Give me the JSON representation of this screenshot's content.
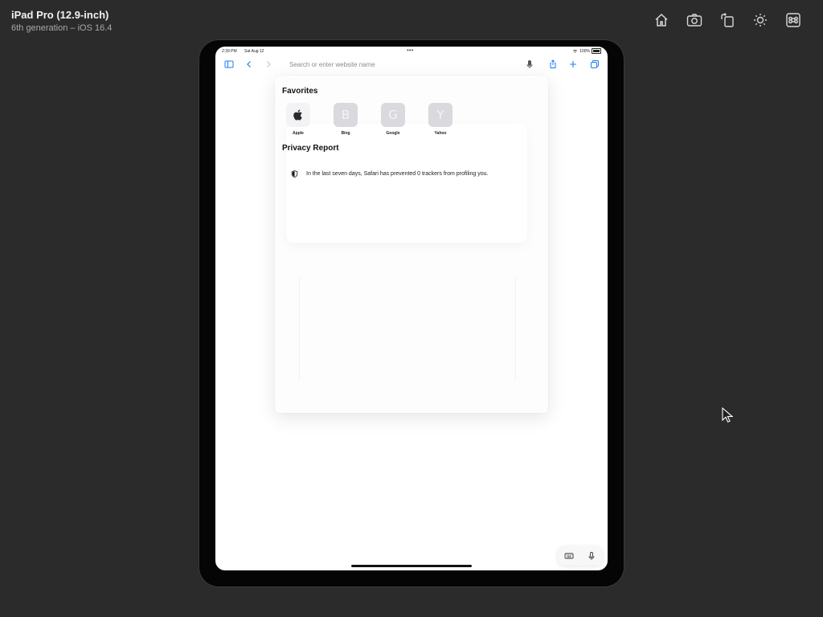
{
  "simulator": {
    "device_name": "iPad Pro (12.9-inch)",
    "device_subtitle": "6th generation – iOS 16.4",
    "toolbar": [
      {
        "icon": "home-icon"
      },
      {
        "icon": "screenshot-icon"
      },
      {
        "icon": "rotate-icon"
      },
      {
        "icon": "appearance-icon"
      },
      {
        "icon": "command-icon"
      }
    ]
  },
  "statusbar": {
    "time": "2:39 PM",
    "date": "Sat Aug 12",
    "battery": "100%"
  },
  "safari": {
    "address_placeholder": "Search or enter website name",
    "favorites_title": "Favorites",
    "favorites": [
      {
        "label": "Apple",
        "letter": ""
      },
      {
        "label": "Bing",
        "letter": "B"
      },
      {
        "label": "Google",
        "letter": "G"
      },
      {
        "label": "Yahoo",
        "letter": "Y"
      }
    ],
    "privacy_title": "Privacy Report",
    "privacy_text": "In the last seven days, Safari has prevented 0 trackers from profiling you."
  },
  "colors": {
    "background": "#2b2b2b",
    "tint": "#1a7cf5",
    "tile": "#d9d9de"
  }
}
